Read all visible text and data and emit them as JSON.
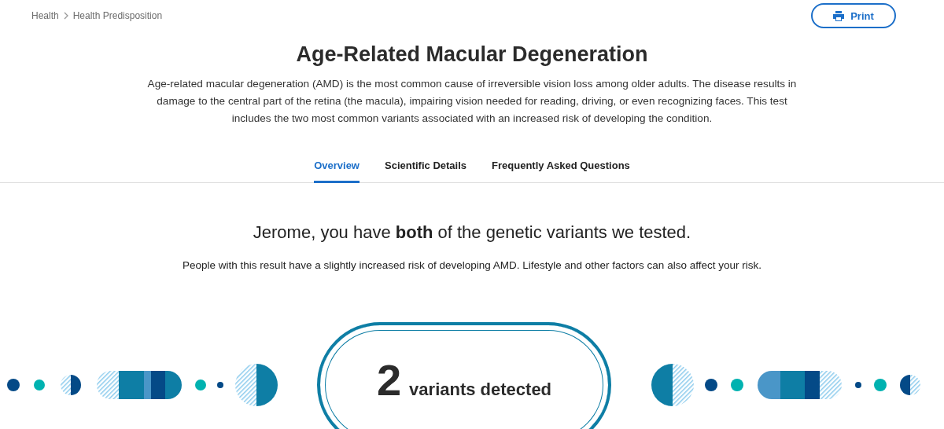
{
  "breadcrumb": [
    {
      "label": "Health"
    },
    {
      "label": "Health Predisposition"
    }
  ],
  "print_button": {
    "label": "Print"
  },
  "title": "Age-Related Macular Degeneration",
  "description": "Age-related macular degeneration (AMD) is the most common cause of irreversible vision loss among older adults. The disease results in damage to the central part of the retina (the macula), impairing vision needed for reading, driving, or even recognizing faces. This test includes the two most common variants associated with an increased risk of developing the condition.",
  "tabs": [
    {
      "label": "Overview",
      "selected": true
    },
    {
      "label": "Scientific Details",
      "selected": false
    },
    {
      "label": "Frequently Asked Questions",
      "selected": false
    }
  ],
  "result": {
    "headline": "Jerome, you have **both** of the genetic variants we tested.",
    "summary": "People with this result have a slightly increased risk of developing AMD. Lifestyle and other factors can also affect your risk.",
    "count": "2",
    "count_label": "variants detected"
  }
}
